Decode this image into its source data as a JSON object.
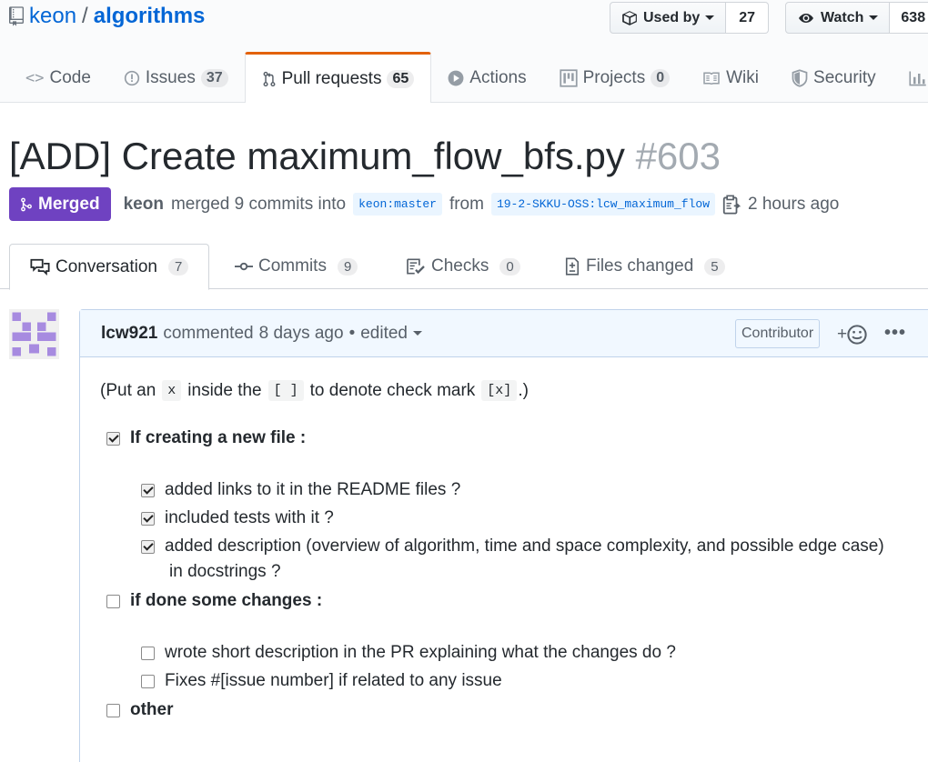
{
  "repo": {
    "owner": "keon",
    "separator": "/",
    "name": "algorithms",
    "used_by_label": "Used by",
    "used_by_count": "27",
    "watch_label": "Watch",
    "watch_count": "638"
  },
  "nav": {
    "code": "Code",
    "issues": "Issues",
    "issues_count": "37",
    "pull_requests": "Pull requests",
    "pull_requests_count": "65",
    "actions": "Actions",
    "projects": "Projects",
    "projects_count": "0",
    "wiki": "Wiki",
    "security": "Security",
    "insights": "In"
  },
  "pr": {
    "title": "[ADD] Create maximum_flow_bfs.py",
    "number": "#603",
    "state": "Merged",
    "author": "keon",
    "action_text": "merged 9 commits into",
    "base_branch": "keon:master",
    "from_text": "from",
    "head_branch": "19-2-SKKU-OSS:lcw_maximum_flow",
    "time": "2 hours ago"
  },
  "tabs": {
    "conversation": "Conversation",
    "conversation_count": "7",
    "commits": "Commits",
    "commits_count": "9",
    "checks": "Checks",
    "checks_count": "0",
    "files_changed": "Files changed",
    "files_changed_count": "5"
  },
  "comment": {
    "author": "lcw921",
    "commented": "commented",
    "when": "8 days ago",
    "bullet": "•",
    "edited": "edited",
    "badge": "Contributor",
    "react_plus": "+",
    "menu": "•••",
    "intro_a": "(Put an",
    "intro_code1": "x",
    "intro_b": "inside the",
    "intro_code2": "[ ]",
    "intro_c": "to denote check mark",
    "intro_code3": "[x]",
    "intro_d": ".)",
    "new_file_label": "If creating a new file :",
    "new_file_items": [
      {
        "text": "added links to it in the README files ?",
        "checked": true
      },
      {
        "text": "included tests with it ?",
        "checked": true
      },
      {
        "text": "added description (overview of algorithm, time and space complexity, and possible edge case)",
        "checked": true
      }
    ],
    "new_file_item3_cont": "in docstrings ?",
    "changes_label": "if done some changes :",
    "changes_items": [
      {
        "text": "wrote short description in the PR explaining what the changes do ?",
        "checked": false
      },
      {
        "text": "Fixes #[issue number] if related to any issue",
        "checked": false
      }
    ],
    "other_label": "other"
  },
  "colors": {
    "merged": "#6f42c1",
    "link": "#0366d6",
    "active_tab": "#e36209",
    "comment_head": "#f1f8ff"
  }
}
